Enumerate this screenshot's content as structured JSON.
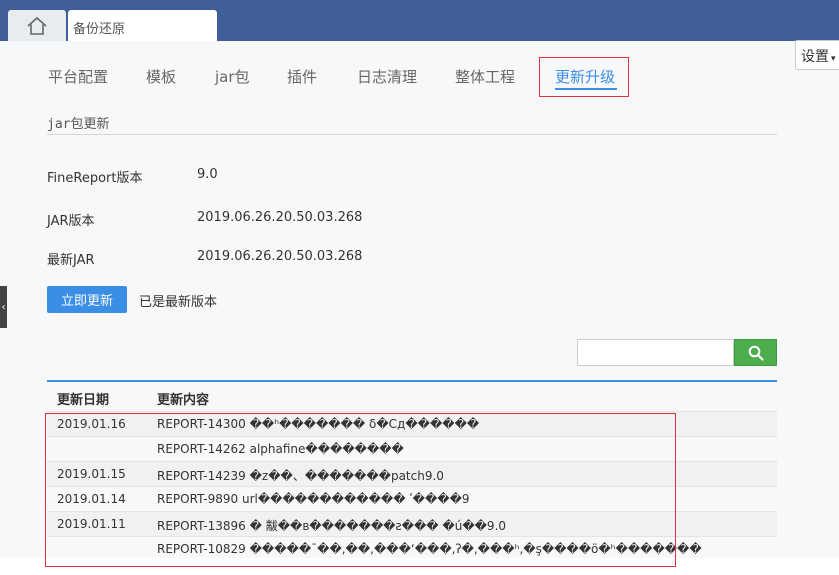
{
  "topbar": {
    "tab_title": "备份还原"
  },
  "settings": {
    "label": "设置",
    "caret": "▾"
  },
  "nav": {
    "items": [
      {
        "label": "平台配置"
      },
      {
        "label": "模板"
      },
      {
        "label": "jar包"
      },
      {
        "label": "插件"
      },
      {
        "label": "日志清理"
      },
      {
        "label": "整体工程"
      },
      {
        "label": "更新升级"
      }
    ]
  },
  "section": {
    "title": "jar包更新"
  },
  "info": {
    "version_label": "FineReport版本",
    "version_value": "9.0",
    "jar_label": "JAR版本",
    "jar_value": "2019.06.26.20.50.03.268",
    "latest_label": "最新JAR",
    "latest_value": "2019.06.26.20.50.03.268"
  },
  "actions": {
    "update_button": "立即更新",
    "status": "已是最新版本"
  },
  "search": {
    "value": "",
    "placeholder": ""
  },
  "table": {
    "headers": {
      "date": "更新日期",
      "content": "更新内容"
    },
    "rows": [
      {
        "date": "2019.01.16",
        "content": "REPORT-14300 ��ʰ�������   δ�Сд������"
      },
      {
        "date": "",
        "content": "REPORT-14262 alphafine��������"
      },
      {
        "date": "2019.01.15",
        "content": "REPORT-14239 �z��、�������patch9.0"
      },
      {
        "date": "2019.01.14",
        "content": "REPORT-9890 url������������ ʹ����9"
      },
      {
        "date": "2019.01.11",
        "content": "REPORT-13896 �   黻��ʙ�������ƨ��� �ú��9.0"
      },
      {
        "date": "",
        "content": "REPORT-10829 �����ˉ��,��,���ʻ���,ʔ�,���ʰ,�ş����ö�ʰ�������"
      }
    ]
  },
  "colors": {
    "accent": "#3a8ee6",
    "highlight": "#e0323c",
    "topbar": "#3f5e9a",
    "search_button": "#4cae4c"
  }
}
